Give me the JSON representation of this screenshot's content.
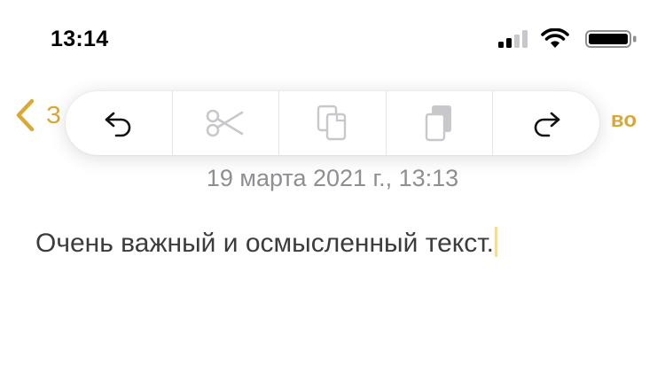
{
  "status_bar": {
    "time": "13:14",
    "icons": [
      "cellular-signal-icon",
      "wifi-icon",
      "battery-icon"
    ]
  },
  "nav": {
    "back_label": "З",
    "done_label": "во",
    "accent_color": "#d9a936"
  },
  "edit_menu": {
    "items": [
      {
        "icon": "undo-icon",
        "enabled": true
      },
      {
        "icon": "cut-icon",
        "enabled": false
      },
      {
        "icon": "copy-icon",
        "enabled": false
      },
      {
        "icon": "paste-icon",
        "enabled": false
      },
      {
        "icon": "redo-icon",
        "enabled": true
      }
    ]
  },
  "note": {
    "date": "19 марта 2021 г., 13:13",
    "text": "Очень важный и осмысленный текст."
  }
}
